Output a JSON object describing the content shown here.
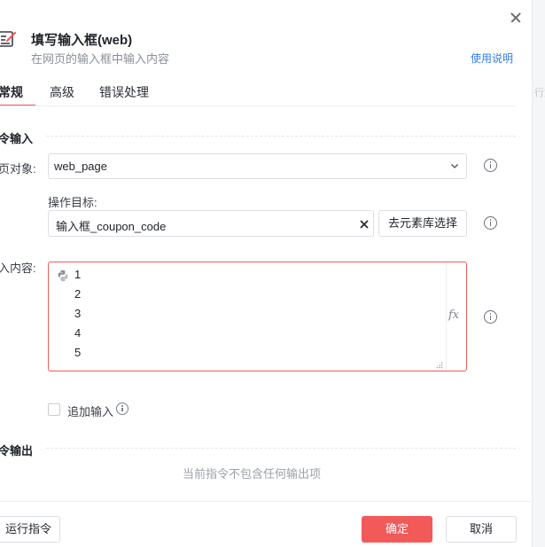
{
  "header": {
    "title": "填写输入框(web)",
    "subtitle": "在网页的输入框中输入内容",
    "help_link": "使用说明",
    "icon": "edit-form-icon"
  },
  "right_edge": {
    "ghost_text": "行文"
  },
  "tabs": [
    {
      "label": "常规",
      "active": true
    },
    {
      "label": "高级",
      "active": false
    },
    {
      "label": "错误处理",
      "active": false
    }
  ],
  "input_section": {
    "title": "令输入",
    "page_object": {
      "label": "页对象:",
      "value": "web_page"
    },
    "target": {
      "label": "操作目标:",
      "value": "输入框_coupon_code",
      "library_button": "去元素库选择"
    },
    "content": {
      "label": "入内容:",
      "lines": [
        "1",
        "2",
        "3",
        "4",
        "5"
      ],
      "fx_label": "fx"
    },
    "append": {
      "label": "追加输入",
      "checked": false
    }
  },
  "output_section": {
    "title": "令输出",
    "empty_text": "当前指令不包含任何输出项"
  },
  "footer": {
    "run_label": "运行指令",
    "ok_label": "确定",
    "cancel_label": "取消"
  },
  "colors": {
    "accent": "#f25a5a",
    "link": "#2f7ce8",
    "error_border": "#ee5b5b"
  }
}
